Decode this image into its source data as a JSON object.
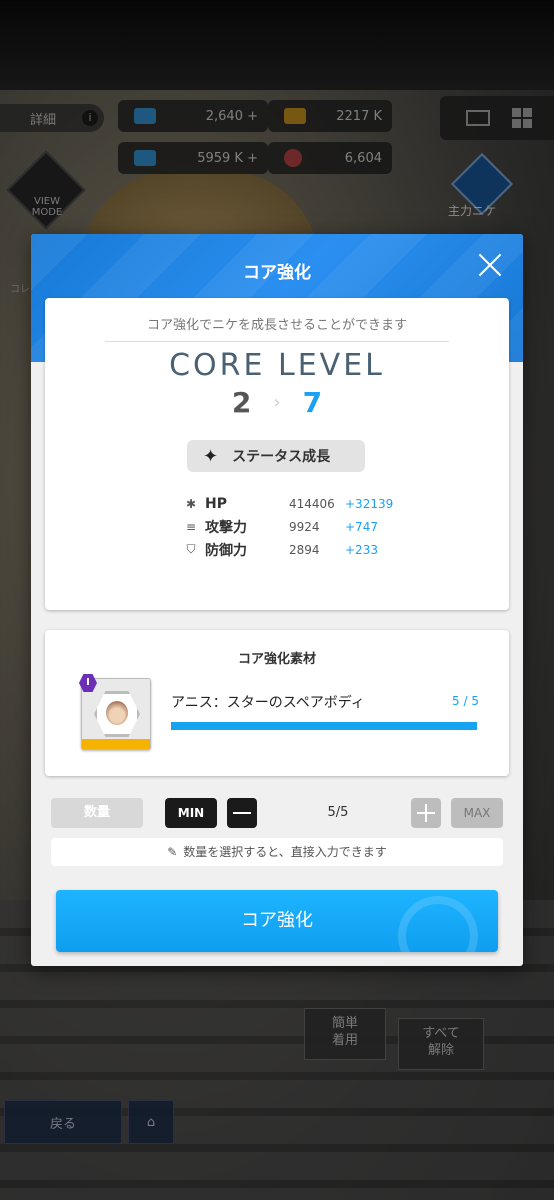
{
  "hud": {
    "details_label": "詳細",
    "info_icon": "info-icon",
    "resources": [
      {
        "value": "2,640 +",
        "icon": "gem-icon",
        "color": "#3aa0e6"
      },
      {
        "value": "2217 K",
        "icon": "battery-icon",
        "color": "#d9a021"
      },
      {
        "value": "5959 K +",
        "icon": "syringe-icon",
        "color": "#3aa0e6"
      },
      {
        "value": "6,604",
        "icon": "orb-icon",
        "color": "#c94a4a"
      }
    ],
    "view_mode_label": "VIEW MODE",
    "main_nikke_label": "主力ニケ",
    "side_label": "コレ"
  },
  "background_buttons": {
    "back_label": "戻る",
    "easy_equip_label": "簡単\n着用",
    "unequip_all_label": "すべて\n解除"
  },
  "modal": {
    "title": "コア強化",
    "subtitle": "コア強化でニケを成長させることができます",
    "core_level_label": "CORE LEVEL",
    "level_from": "2",
    "level_arrow": "›",
    "level_to": "7",
    "status_growth_label": "ステータス成長",
    "stats": [
      {
        "icon": "✱",
        "name": "HP",
        "value": "414406",
        "plus": "+32139"
      },
      {
        "icon": "≡",
        "name": "攻撃力",
        "value": "9924",
        "plus": "+747"
      },
      {
        "icon": "⛉",
        "name": "防御力",
        "value": "2894",
        "plus": "+233"
      }
    ],
    "material": {
      "title": "コア強化素材",
      "badge": "I",
      "name": "アニス：スターのスペアボディ",
      "count": "5 / 5",
      "progress": 1.0
    },
    "quantity": {
      "label": "数量",
      "min_label": "MIN",
      "value": "5/5",
      "max_label": "MAX"
    },
    "hint": "数量を選択すると、直接入力できます",
    "confirm_label": "コア強化"
  },
  "colors": {
    "accent": "#1ba0f2",
    "header_blue": "#1e86e8",
    "rarity_purple": "#6b2fb5"
  }
}
